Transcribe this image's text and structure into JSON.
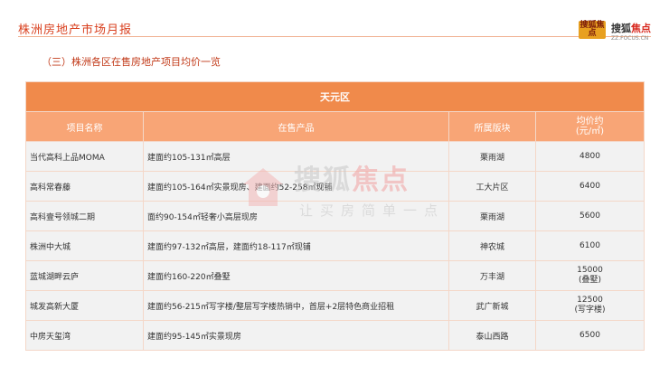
{
  "header": {
    "title": "株洲房地产市场月报",
    "logo_badge": "搜狐焦点",
    "logo_brand_prefix": "搜狐",
    "logo_brand_main": "焦点",
    "logo_url": "ZZ.FOCUS.CN"
  },
  "section": {
    "title": "（三）株洲各区在售房地产项目均价一览"
  },
  "table": {
    "district": "天元区",
    "columns": [
      "项目名称",
      "在售产品",
      "所属版块",
      "均价约\n(元/㎡)"
    ],
    "rows": [
      {
        "name": "当代高科上品MOMA",
        "product": "建面约105-131㎡高层",
        "area": "栗雨湖",
        "price": "4800"
      },
      {
        "name": "高科常春藤",
        "product": "建面约105-164㎡实景现房、建面约52-258㎡现铺",
        "area": "工大片区",
        "price": "6400"
      },
      {
        "name": "高科壹号领城二期",
        "product": "面约90-154㎡轻奢小高层现房",
        "area": "栗雨湖",
        "price": "5600"
      },
      {
        "name": "株洲中大城",
        "product": "建面约97-132㎡高层，建面约18-117㎡现铺",
        "area": "神农城",
        "price": "6100"
      },
      {
        "name": "蓝城湖畔云庐",
        "product": "建面约160-220㎡叠墅",
        "area": "万丰湖",
        "price": "15000\n(叠墅)"
      },
      {
        "name": "城发高新大厦",
        "product": "建面约56-215㎡写字楼/整层写字楼热销中，首层+2层特色商业招租",
        "area": "武广新城",
        "price": "12500\n(写字楼)"
      },
      {
        "name": "中房天玺湾",
        "product": "建面约95-145㎡实景现房",
        "area": "泰山西路",
        "price": "6500"
      }
    ]
  },
  "watermark": {
    "brand_plain": "搜狐",
    "brand_highlight": "焦点",
    "slogan": "让买房简单一点"
  },
  "colors": {
    "accent": "#d9401f",
    "district_bg": "#f08a4b",
    "header_bg": "#f8a576",
    "row_bg": "#f2f2f2"
  }
}
